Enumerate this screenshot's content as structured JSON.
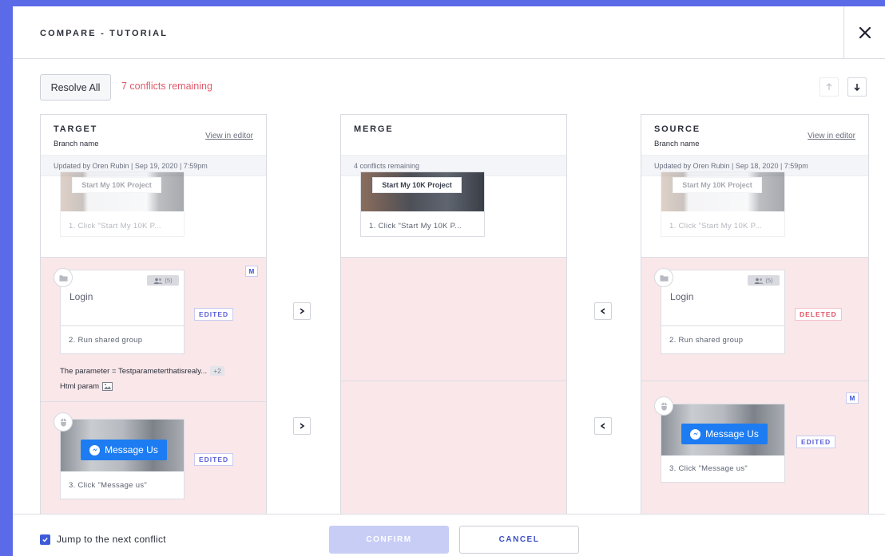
{
  "header": {
    "title": "COMPARE - TUTORIAL"
  },
  "toolbar": {
    "resolve_all_label": "Resolve All",
    "conflicts_remaining": "7 conflicts remaining"
  },
  "target": {
    "title": "TARGET",
    "subtitle": "Branch name",
    "view_link": "View in editor",
    "meta": "Updated by Oren Rubin | Sep 19, 2020 | 7:59pm",
    "step1": {
      "button_text": "Start My 10K Project",
      "caption": "1. Click \"Start My 10K P..."
    },
    "step2": {
      "card_label": "Login",
      "group_count": "(5)",
      "caption": "2. Run shared group",
      "status": "EDITED",
      "modified_marker": "M",
      "param_line": "The parameter = Testparameterthatisrealy...",
      "param_more": "+2",
      "html_param": "Html param"
    },
    "step3": {
      "button_text": "Message Us",
      "caption": "3. Click \"Message us\"",
      "status": "EDITED"
    }
  },
  "merge": {
    "title": "MERGE",
    "meta": "4 conflicts remaining",
    "step1": {
      "button_text": "Start My 10K Project",
      "caption": "1. Click \"Start My 10K P..."
    }
  },
  "source": {
    "title": "SOURCE",
    "subtitle": "Branch name",
    "view_link": "View in editor",
    "meta": "Updated by Oren Rubin | Sep 18, 2020 | 7:59pm",
    "step1": {
      "button_text": "Start My 10K Project",
      "caption": "1. Click \"Start My 10K P..."
    },
    "step2": {
      "card_label": "Login",
      "group_count": "(5)",
      "caption": "2. Run shared group",
      "status": "DELETED"
    },
    "step3": {
      "button_text": "Message Us",
      "caption": "3. Click \"Message us\"",
      "status": "EDITED",
      "modified_marker": "M"
    }
  },
  "footer": {
    "jump_label": "Jump to the next conflict",
    "jump_checked": true,
    "confirm_label": "CONFIRM",
    "cancel_label": "CANCEL"
  },
  "colors": {
    "backdrop": "#5b6ae6",
    "conflict_bg": "#f9e7ea",
    "accent": "#3d5bd9",
    "danger": "#e05a6a",
    "messenger": "#1d7cf2"
  },
  "icons": [
    "close-icon",
    "arrow-up-icon",
    "arrow-down-icon",
    "folder-icon",
    "mouse-icon",
    "users-icon",
    "image-icon",
    "chevron-right-icon",
    "chevron-left-icon",
    "checkmark-icon",
    "messenger-icon"
  ]
}
